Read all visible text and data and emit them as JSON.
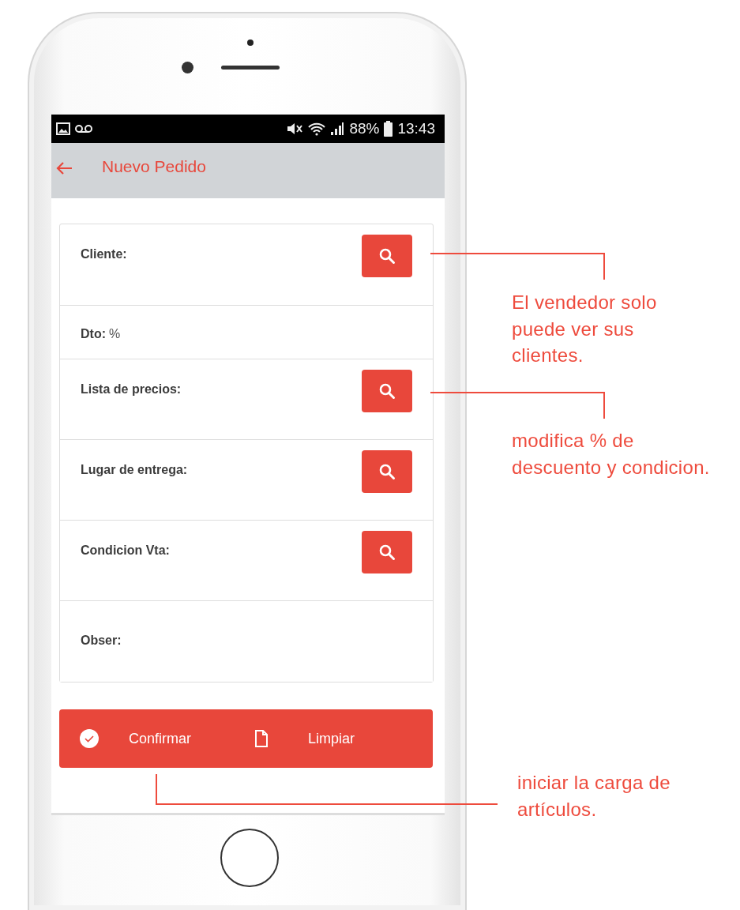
{
  "status_bar": {
    "battery": "88%",
    "time": "13:43"
  },
  "app_bar": {
    "title": "Nuevo Pedido"
  },
  "form": {
    "fields": [
      {
        "kind": "lookup",
        "label": "Cliente:"
      },
      {
        "kind": "text",
        "label": "Dto:",
        "value": "%"
      },
      {
        "kind": "lookup",
        "label": "Lista de precios:"
      },
      {
        "kind": "lookup",
        "label": "Lugar de entrega:"
      },
      {
        "kind": "lookup",
        "label": "Condicion Vta:"
      },
      {
        "kind": "textarea",
        "placeholder": "Obser:"
      }
    ]
  },
  "actions": [
    {
      "kind": "confirm",
      "label": "Confirmar"
    },
    {
      "kind": "clear",
      "label": "Limpiar"
    }
  ],
  "annotations": [
    {
      "lines": [
        "El vendedor solo",
        "puede ver sus",
        "clientes."
      ]
    },
    {
      "lines": [
        "modifica % de",
        "descuento y condicion."
      ]
    },
    {
      "lines": [
        "iniciar la carga de",
        "artículos."
      ]
    }
  ]
}
